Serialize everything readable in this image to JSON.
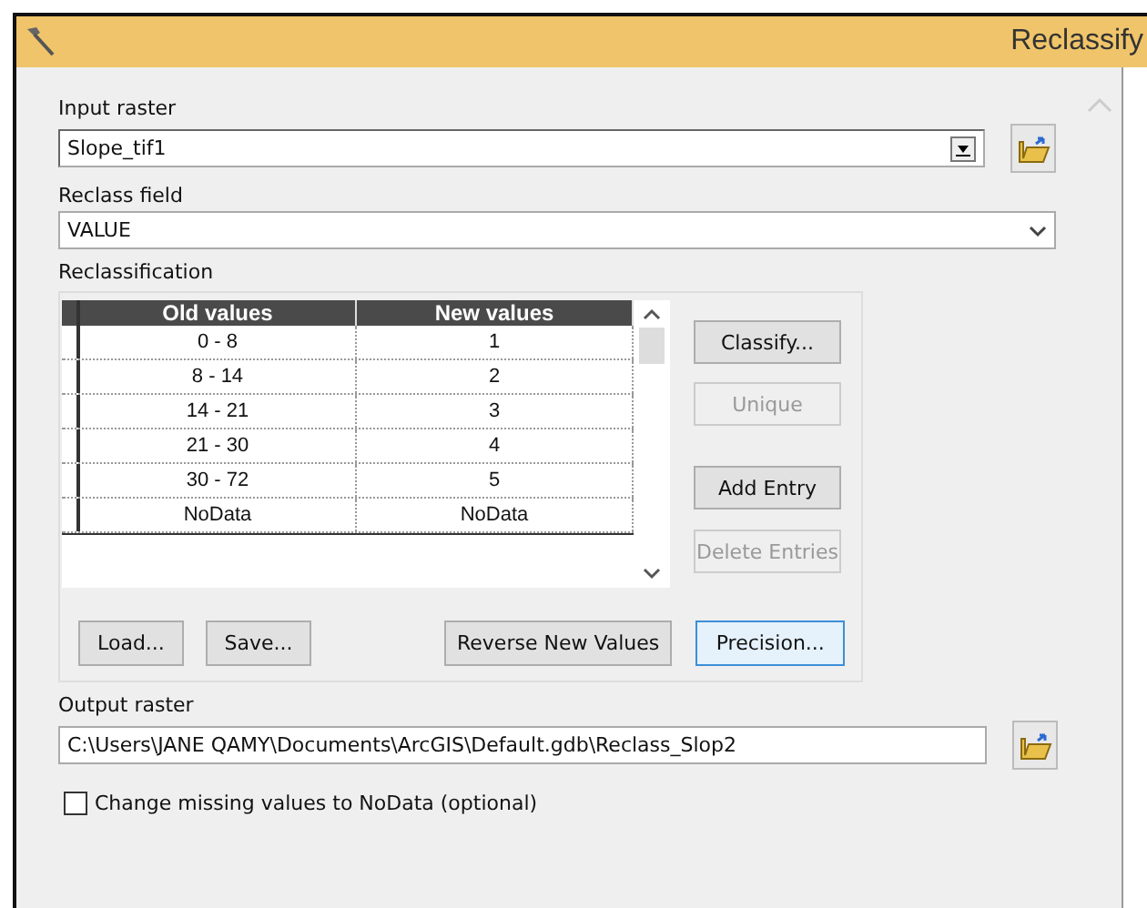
{
  "window": {
    "title": "Reclassify"
  },
  "input_raster": {
    "label": "Input raster",
    "value": "Slope_tif1"
  },
  "reclass_field": {
    "label": "Reclass field",
    "value": "VALUE"
  },
  "reclassification": {
    "label": "Reclassification",
    "table": {
      "columns": [
        "Old values",
        "New values"
      ],
      "rows": [
        {
          "old": "0 - 8",
          "new": "1"
        },
        {
          "old": "8 - 14",
          "new": "2"
        },
        {
          "old": "14 - 21",
          "new": "3"
        },
        {
          "old": "21 - 30",
          "new": "4"
        },
        {
          "old": "30 - 72",
          "new": "5"
        },
        {
          "old": "NoData",
          "new": "NoData"
        }
      ]
    },
    "side_buttons": [
      {
        "label": "Classify...",
        "disabled": false
      },
      {
        "label": "Unique",
        "disabled": true
      },
      {
        "label": "Add Entry",
        "disabled": false
      },
      {
        "label": "Delete Entries",
        "disabled": true
      }
    ],
    "bottom_buttons": [
      {
        "label": "Load...",
        "focused": false
      },
      {
        "label": "Save...",
        "focused": false
      },
      {
        "label": "Reverse New Values",
        "focused": false
      },
      {
        "label": "Precision...",
        "focused": true
      }
    ]
  },
  "output_raster": {
    "label": "Output raster",
    "value": "C:\\Users\\JANE QAMY\\Documents\\ArcGIS\\Default.gdb\\Reclass_Slop2"
  },
  "missing_to_nodata": {
    "label": "Change missing values to NoData (optional)",
    "checked": false
  }
}
